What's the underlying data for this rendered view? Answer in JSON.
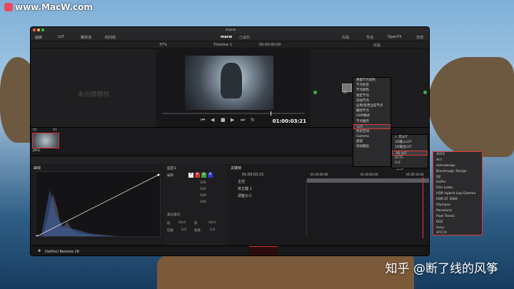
{
  "watermark": {
    "site": "www.MacW.com"
  },
  "caption": "知乎 @断了线的风筝",
  "window": {
    "title": "macw",
    "topbar": {
      "left": [
        "画廊",
        "LUT",
        "媒体池",
        "时间线"
      ],
      "center": "macw",
      "center_sub": "已编辑",
      "right": [
        "片段",
        "节点",
        "OpenFX",
        "光线"
      ]
    },
    "toolbar": {
      "zoom": "37%",
      "timeline": "Timeline 1",
      "timecode": "00:00:00:00",
      "clip_label": "片段"
    },
    "gallery_empty": "未创建静帧",
    "viewer": {
      "timecode": "01:00:03:21"
    },
    "node_label": "01",
    "clip": {
      "number": "01",
      "track": "V1",
      "format": "JPEG"
    },
    "curves": {
      "title": "曲线"
    },
    "controls": {
      "edit_label": "编辑",
      "channels": [
        "Y",
        "R",
        "G",
        "B"
      ],
      "values": [
        "100",
        "100",
        "100",
        "100"
      ],
      "soft_clip_label": "柔化裁切",
      "low_label": "低",
      "low_val": "50.0",
      "high_label": "高",
      "high_val": "50.0",
      "low_soft_label": "低柔",
      "low_soft_val": "0.0",
      "high_soft_label": "高柔",
      "high_soft_val": "0.0",
      "custom_label": "自定义"
    },
    "keyframes": {
      "title": "关键帧",
      "filter": "全部",
      "timecode": "01:00:03:21",
      "ruler": [
        "01:00:00:00",
        "01:00:05:00",
        "01:00:10:00"
      ],
      "rows": [
        "主控",
        "校正器 1",
        "调整大小"
      ]
    },
    "app_name": "DaVinci Resolve 16"
  },
  "context_menu": [
    "重置节点调色",
    "节点标签",
    "节点颜色",
    "锁定节点",
    "添加节点",
    "启用/禁用当前节点",
    "删除节点",
    "HDR模式",
    "节点缓存",
    "LUT",
    "色彩空间",
    "Gamma",
    "通道",
    "添加输出"
  ],
  "lut_submenu": [
    "无LUT",
    "1D输入LUT",
    "1D输出LUT",
    "3D LUT",
    "DCTL",
    "CLF"
  ],
  "lut_list": [
    "ACES",
    "Arri",
    "Astrodesign",
    "Blackmagic Design",
    "DJI",
    "GoPro",
    "Film Looks",
    "HDR Hybrid Log-Gamma",
    "HDR ST 2084",
    "Olympus",
    "Panasonic",
    "Pixel Tennis",
    "RED",
    "Sony",
    "VFX IO"
  ],
  "colors": {
    "highlight": "#e03a3a",
    "panel": "#1c1c1e",
    "menu": "#2b2b2d"
  }
}
